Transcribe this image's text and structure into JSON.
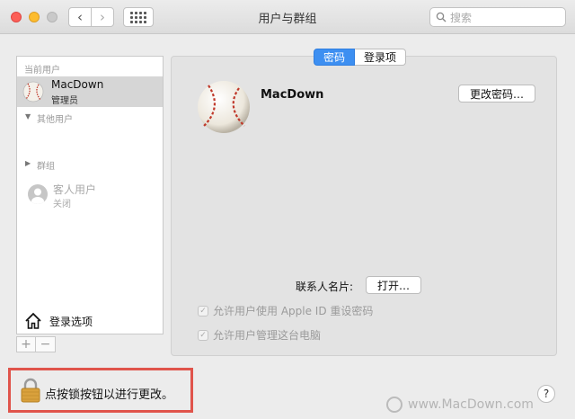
{
  "window": {
    "title": "用户与群组"
  },
  "search": {
    "placeholder": "搜索"
  },
  "sidebar": {
    "current_users_header": "当前用户",
    "current_user": {
      "name": "MacDown",
      "role": "管理员"
    },
    "other_users_header": "其他用户",
    "guest_user": {
      "name": "客人用户",
      "status": "关闭"
    },
    "groups_header": "群组",
    "login_options": "登录选项",
    "add_label": "+",
    "remove_label": "−"
  },
  "tabs": [
    {
      "label": "密码",
      "active": true
    },
    {
      "label": "登录项",
      "active": false
    }
  ],
  "main": {
    "user_name": "MacDown",
    "change_password_button": "更改密码…",
    "contact_card_label": "联系人名片:",
    "open_button": "打开…",
    "checkbox_apple_id": {
      "label": "允许用户使用 Apple ID 重设密码",
      "checked": true,
      "enabled": false
    },
    "checkbox_admin": {
      "label": "允许用户管理这台电脑",
      "checked": true,
      "enabled": false
    }
  },
  "footer": {
    "lock_message": "点按锁按钮以进行更改。",
    "help_label": "?",
    "watermark": "www.MacDown.com"
  },
  "colors": {
    "accent": "#3d8ff1",
    "highlight_border": "#e0544b",
    "selected_row": "#d6d6d6"
  },
  "icons": [
    "back-arrow-icon",
    "forward-arrow-icon",
    "grid-icon",
    "search-icon",
    "baseball-avatar-icon",
    "guest-avatar-icon",
    "house-icon",
    "lock-icon",
    "help-icon"
  ]
}
